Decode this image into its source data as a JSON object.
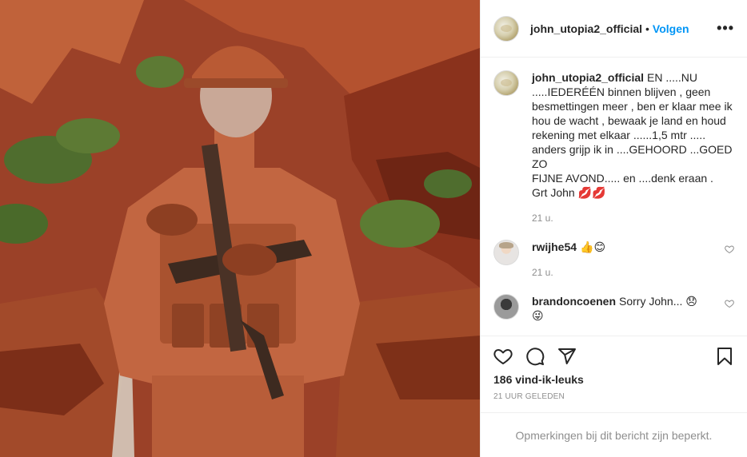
{
  "post": {
    "username": "john_utopia2_official",
    "follow_label": "Volgen",
    "dot": "•",
    "more_label": "•••"
  },
  "caption": {
    "username": "john_utopia2_official",
    "text": "EN .....NU\n.....IEDERÉÉN binnen blijven , geen besmettingen meer , ben er klaar mee ik hou de wacht , bewaak je land en houd rekening met elkaar ......1,5 mtr ..... anders grijp ik in ....GEHOORD ...GOED ZO\nFIJNE AVOND..... en ....denk eraan .\nGrt John 💋💋",
    "time": "21 u."
  },
  "comments": [
    {
      "username": "rwijhe54",
      "text": "👍😊",
      "time": "21 u."
    },
    {
      "username": "brandoncoenen",
      "text": "Sorry John... 😞\n😜"
    }
  ],
  "icons": {
    "like": "heart-icon",
    "comment": "comment-icon",
    "share": "share-icon",
    "save": "bookmark-icon",
    "more": "more-icon"
  },
  "likes_label": "186 vind-ik-leuks",
  "posted_label": "21 UUR GELEDEN",
  "restricted_label": "Opmerkingen bij dit bericht zijn beperkt.",
  "colors": {
    "accent": "#0095f6",
    "secondary_text": "#8e8e8e",
    "border": "#efefef"
  }
}
